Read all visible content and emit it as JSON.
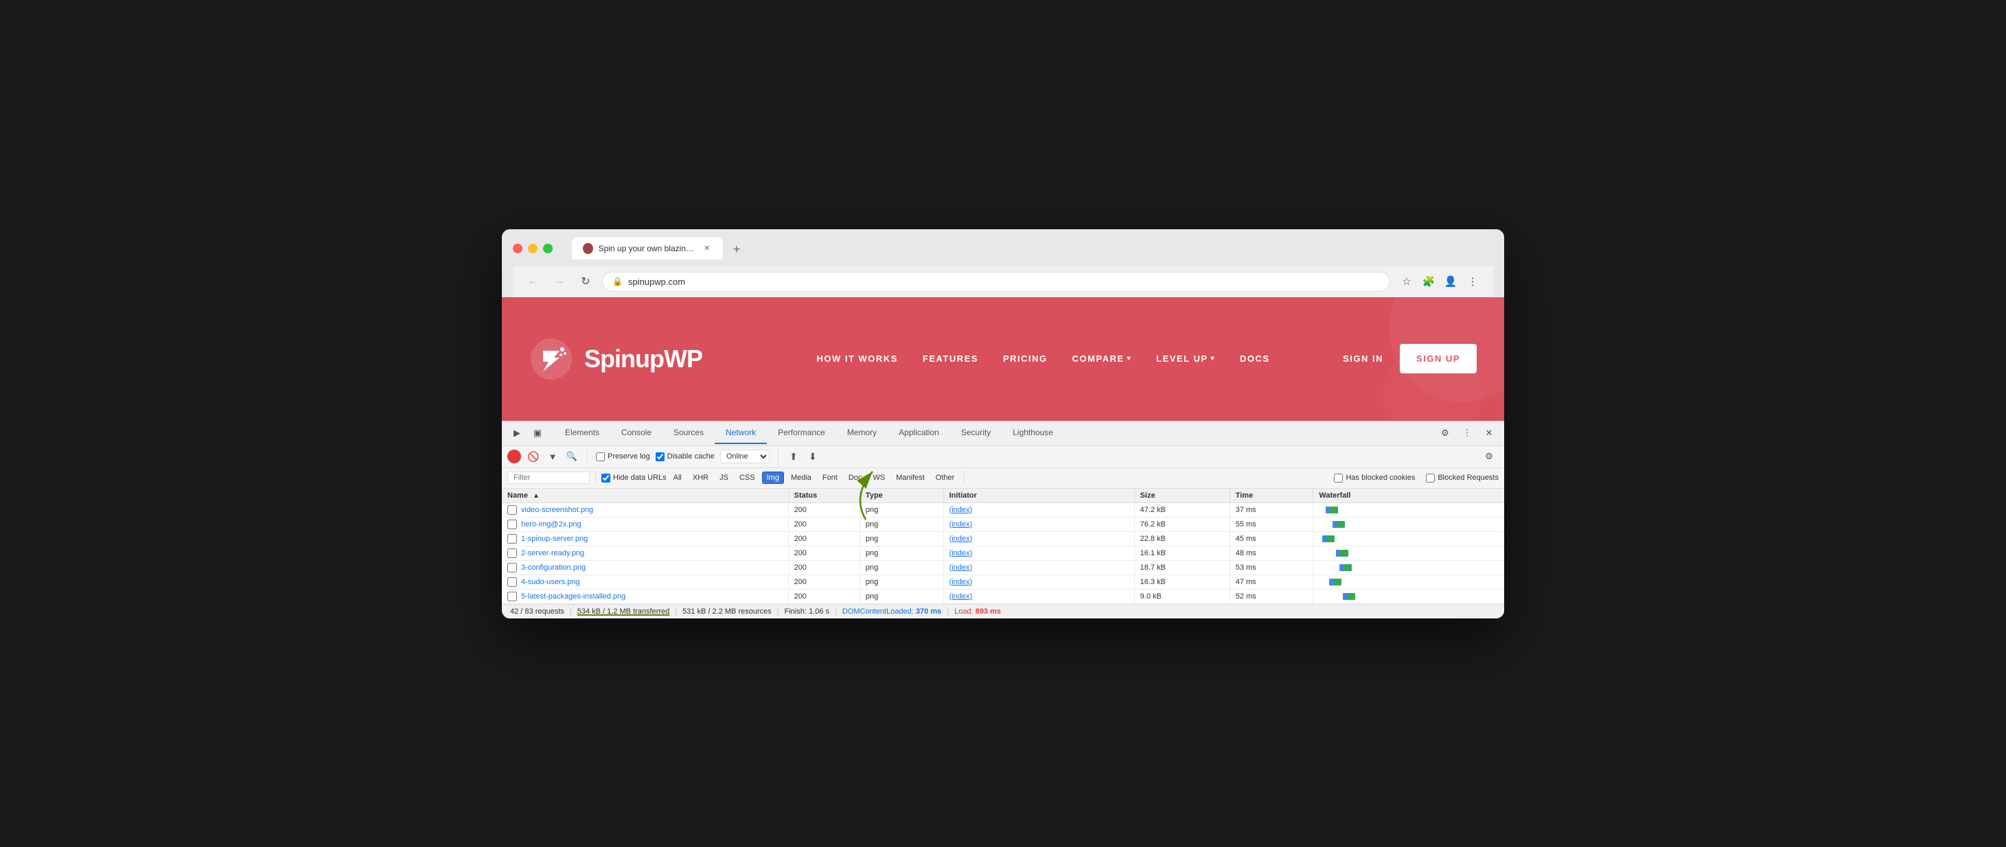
{
  "browser": {
    "tab_title": "Spin up your own blazing fast ",
    "url": "spinupwp.com",
    "new_tab_label": "+"
  },
  "website": {
    "logo_text": "SpinupWP",
    "nav_items": [
      {
        "label": "HOW IT WORKS",
        "has_dropdown": false
      },
      {
        "label": "FEATURES",
        "has_dropdown": false
      },
      {
        "label": "PRICING",
        "has_dropdown": false
      },
      {
        "label": "COMPARE",
        "has_dropdown": true
      },
      {
        "label": "LEVEL UP",
        "has_dropdown": true
      },
      {
        "label": "DOCS",
        "has_dropdown": false
      }
    ],
    "sign_in_label": "SIGN IN",
    "sign_up_label": "SIGN UP"
  },
  "devtools": {
    "tabs": [
      {
        "label": "Elements",
        "active": false
      },
      {
        "label": "Console",
        "active": false
      },
      {
        "label": "Sources",
        "active": false
      },
      {
        "label": "Network",
        "active": true
      },
      {
        "label": "Performance",
        "active": false
      },
      {
        "label": "Memory",
        "active": false
      },
      {
        "label": "Application",
        "active": false
      },
      {
        "label": "Security",
        "active": false
      },
      {
        "label": "Lighthouse",
        "active": false
      }
    ],
    "filter_bar": {
      "preserve_log_label": "Preserve log",
      "disable_cache_label": "Disable cache",
      "online_label": "Online"
    },
    "filter_types": [
      {
        "label": "Hide data URLs",
        "is_checkbox": true,
        "checked": true
      },
      {
        "label": "All",
        "is_checkbox": false,
        "active": false
      },
      {
        "label": "XHR",
        "is_checkbox": false,
        "active": false
      },
      {
        "label": "JS",
        "is_checkbox": false,
        "active": false
      },
      {
        "label": "CSS",
        "is_checkbox": false,
        "active": false
      },
      {
        "label": "Img",
        "is_checkbox": false,
        "active": true
      },
      {
        "label": "Media",
        "is_checkbox": false,
        "active": false
      },
      {
        "label": "Font",
        "is_checkbox": false,
        "active": false
      },
      {
        "label": "Doc",
        "is_checkbox": false,
        "active": false
      },
      {
        "label": "WS",
        "is_checkbox": false,
        "active": false
      },
      {
        "label": "Manifest",
        "is_checkbox": false,
        "active": false
      },
      {
        "label": "Other",
        "is_checkbox": false,
        "active": false
      }
    ],
    "has_blocked_cookies": "Has blocked cookies",
    "blocked_requests": "Blocked Requests",
    "table": {
      "columns": [
        "Name",
        "Status",
        "Type",
        "Initiator",
        "Size",
        "Time",
        "Waterfall"
      ],
      "rows": [
        {
          "name": "video-screenshot.png",
          "status": "200",
          "type": "png",
          "initiator": "(index)",
          "size": "47.2 kB",
          "time": "37 ms",
          "wf_color1": "#4285f4",
          "wf_color2": "#34a853"
        },
        {
          "name": "hero-img@2x.png",
          "status": "200",
          "type": "png",
          "initiator": "(index)",
          "size": "76.2 kB",
          "time": "55 ms",
          "wf_color1": "#4285f4",
          "wf_color2": "#34a853"
        },
        {
          "name": "1-spinup-server.png",
          "status": "200",
          "type": "png",
          "initiator": "(index)",
          "size": "22.8 kB",
          "time": "45 ms",
          "wf_color1": "#4285f4",
          "wf_color2": "#34a853"
        },
        {
          "name": "2-server-ready.png",
          "status": "200",
          "type": "png",
          "initiator": "(index)",
          "size": "16.1 kB",
          "time": "48 ms",
          "wf_color1": "#4285f4",
          "wf_color2": "#34a853"
        },
        {
          "name": "3-configuration.png",
          "status": "200",
          "type": "png",
          "initiator": "(index)",
          "size": "18.7 kB",
          "time": "53 ms",
          "wf_color1": "#4285f4",
          "wf_color2": "#34a853"
        },
        {
          "name": "4-sudo-users.png",
          "status": "200",
          "type": "png",
          "initiator": "(index)",
          "size": "16.3 kB",
          "time": "47 ms",
          "wf_color1": "#4285f4",
          "wf_color2": "#34a853"
        },
        {
          "name": "5-latest-packages-installed.png",
          "status": "200",
          "type": "png",
          "initiator": "(index)",
          "size": "9.0 kB",
          "time": "52 ms",
          "wf_color1": "#4285f4",
          "wf_color2": "#34a853"
        }
      ]
    },
    "statusbar": {
      "requests": "42 / 83 requests",
      "transferred": "534 kB / 1.2 MB transferred",
      "resources": "531 kB / 2.2 MB resources",
      "finish": "Finish: 1.06 s",
      "dom_content_loaded_label": "DOMContentLoaded:",
      "dom_content_loaded_value": "370 ms",
      "load_label": "Load:",
      "load_value": "893 ms"
    },
    "filter_placeholder": "Filter"
  }
}
